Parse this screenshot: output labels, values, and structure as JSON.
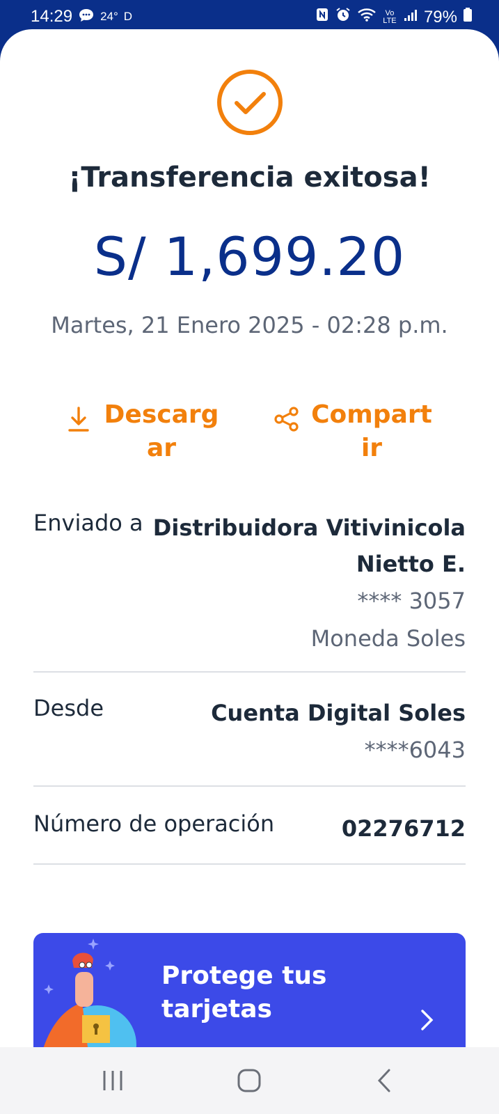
{
  "status_bar": {
    "time": "14:29",
    "temperature": "24°",
    "network_letter": "D",
    "volte": "Vo LTE",
    "battery": "79%"
  },
  "receipt": {
    "title": "¡Transferencia exitosa!",
    "amount": "S/ 1,699.20",
    "datetime": "Martes, 21 Enero 2025 - 02:28 p.m.",
    "actions": {
      "download_label": "Descargar",
      "share_label": "Compartir"
    },
    "sent_to": {
      "key": "Enviado a",
      "name_line1": "Distribuidora Vitivinicola",
      "name_line2": "Nietto E.",
      "account": "**** 3057",
      "currency": "Moneda Soles"
    },
    "from": {
      "key": "Desde",
      "account_name": "Cuenta Digital Soles",
      "account_number": "****6043"
    },
    "operation": {
      "key": "Número de operación",
      "value": "02276712"
    }
  },
  "promo": {
    "title": "Protege tus tarjetas"
  },
  "colors": {
    "brand_blue": "#0a2f8a",
    "accent_orange": "#f2800c",
    "promo_blue": "#3c4ae8"
  },
  "icons": {
    "success": "check-circle-icon",
    "download": "download-icon",
    "share": "share-icon",
    "promo_next": "chevron-right-icon",
    "nav_recents": "recents-icon",
    "nav_home": "home-icon",
    "nav_back": "back-icon"
  }
}
